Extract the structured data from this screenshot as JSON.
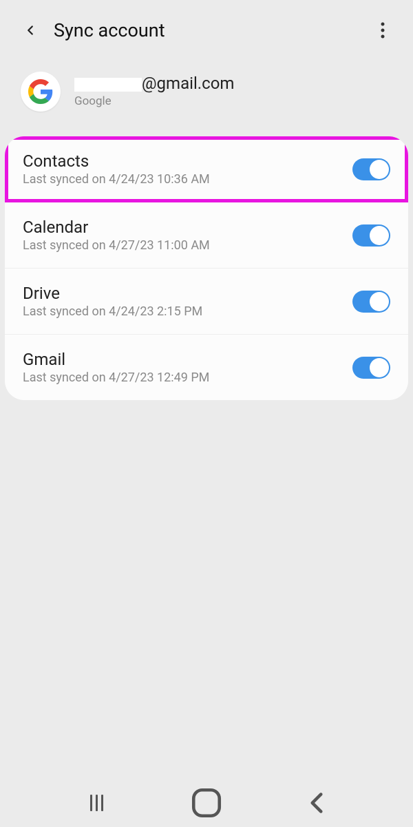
{
  "header": {
    "title": "Sync account"
  },
  "account": {
    "email_suffix": "@gmail.com",
    "provider": "Google"
  },
  "sync_items": [
    {
      "name": "Contacts",
      "status": "Last synced on 4/24/23  10:36 AM",
      "highlighted": true
    },
    {
      "name": "Calendar",
      "status": "Last synced on 4/27/23  11:00 AM",
      "highlighted": false
    },
    {
      "name": "Drive",
      "status": "Last synced on 4/24/23  2:15 PM",
      "highlighted": false
    },
    {
      "name": "Gmail",
      "status": "Last synced on 4/27/23  12:49 PM",
      "highlighted": false
    }
  ]
}
